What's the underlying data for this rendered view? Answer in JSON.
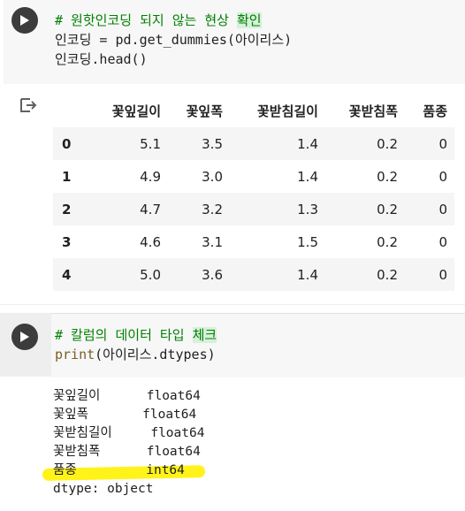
{
  "cell1": {
    "code_lines": [
      "# 원핫인코딩 되지 않는 현상 확인",
      "인코딩 = pd.get_dummies(아이리스)",
      "인코딩.head()"
    ],
    "comment_prefix": "# 원핫인코딩 되지 않는 현상 ",
    "comment_highlight": "확인",
    "line2": "인코딩 = pd.get_dummies(아이리스)",
    "line3": "인코딩.head()"
  },
  "dataframe": {
    "columns": [
      "꽃잎길이",
      "꽃잎폭",
      "꽃받침길이",
      "꽃받침폭",
      "품종"
    ],
    "rows": [
      {
        "index": "0",
        "values": [
          "5.1",
          "3.5",
          "1.4",
          "0.2",
          "0"
        ]
      },
      {
        "index": "1",
        "values": [
          "4.9",
          "3.0",
          "1.4",
          "0.2",
          "0"
        ]
      },
      {
        "index": "2",
        "values": [
          "4.7",
          "3.2",
          "1.3",
          "0.2",
          "0"
        ]
      },
      {
        "index": "3",
        "values": [
          "4.6",
          "3.1",
          "1.5",
          "0.2",
          "0"
        ]
      },
      {
        "index": "4",
        "values": [
          "5.0",
          "3.6",
          "1.4",
          "0.2",
          "0"
        ]
      }
    ]
  },
  "cell2": {
    "comment_prefix": "# 칼럼의 데이터 타입 ",
    "comment_highlight": "체크",
    "print_fn": "print",
    "print_args": "(아이리스.dtypes)"
  },
  "dtypes_output": [
    "꽃잎길이      float64",
    "꽃잎폭       float64",
    "꽃받침길이     float64",
    "꽃받침폭      float64",
    "품종         int64",
    "dtype: object"
  ],
  "colors": {
    "highlighter": "#fff200",
    "comment": "#008000",
    "run_button": "#3c3c3c"
  },
  "icons": {
    "run": "play-icon",
    "output": "output-arrow-icon"
  }
}
